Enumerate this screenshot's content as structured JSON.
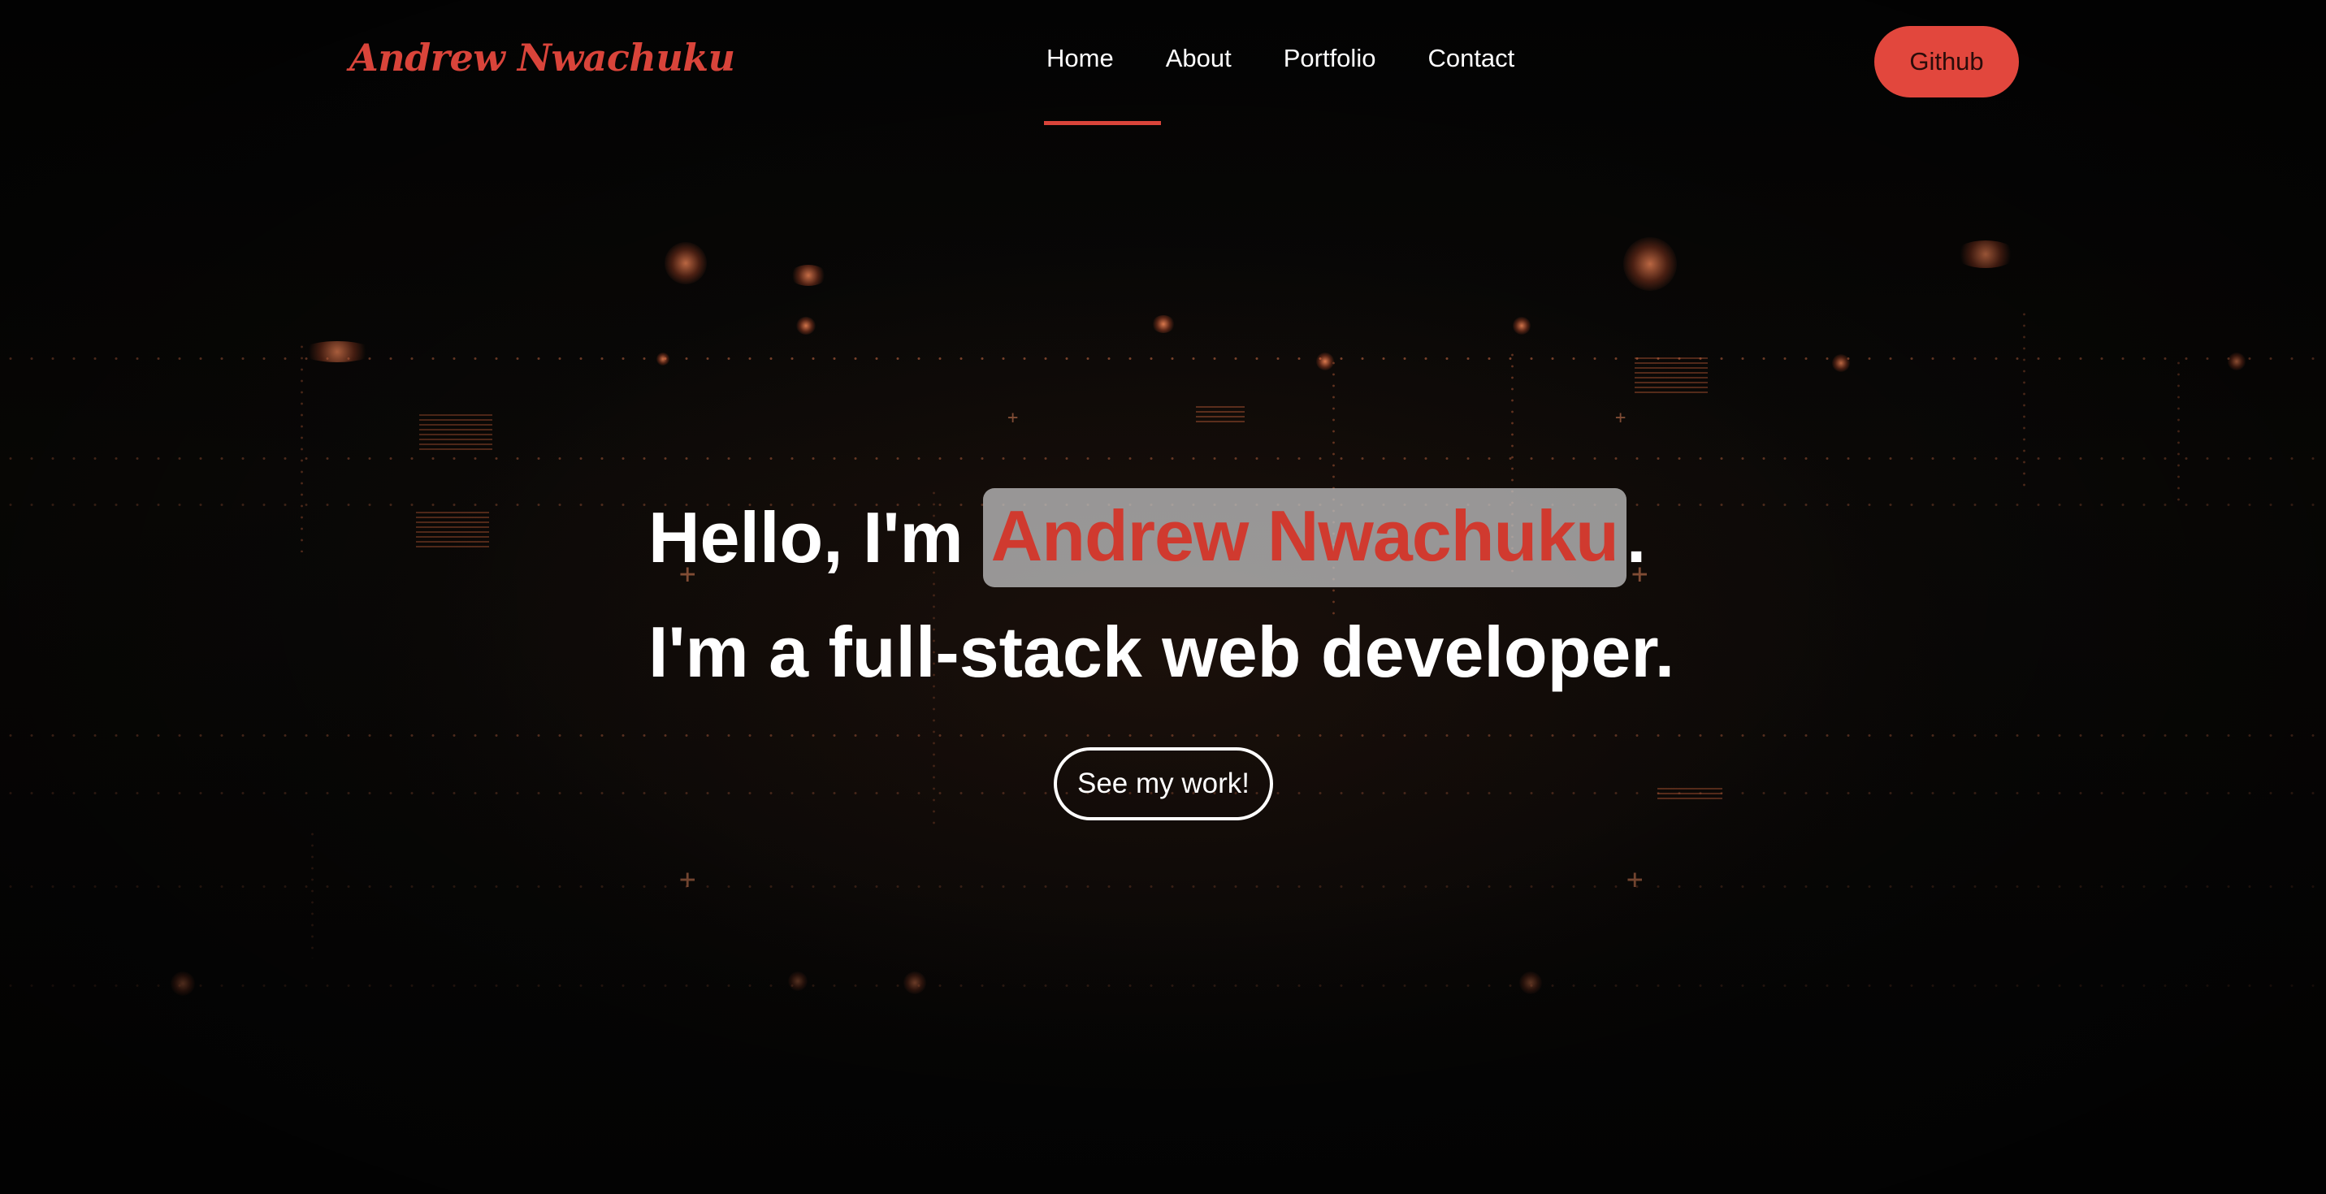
{
  "brand": {
    "name": "Andrew Nwachuku",
    "accent_color": "#d9443a"
  },
  "nav": {
    "items": [
      {
        "label": "Home",
        "active": true
      },
      {
        "label": "About",
        "active": false
      },
      {
        "label": "Portfolio",
        "active": false
      },
      {
        "label": "Contact",
        "active": false
      }
    ],
    "github_label": "Github"
  },
  "hero": {
    "greeting_prefix": "Hello, I'm",
    "name": "Andrew Nwachuku",
    "greeting_suffix": ".",
    "tagline": "I'm a full-stack web developer.",
    "cta_label": "See my work!"
  }
}
